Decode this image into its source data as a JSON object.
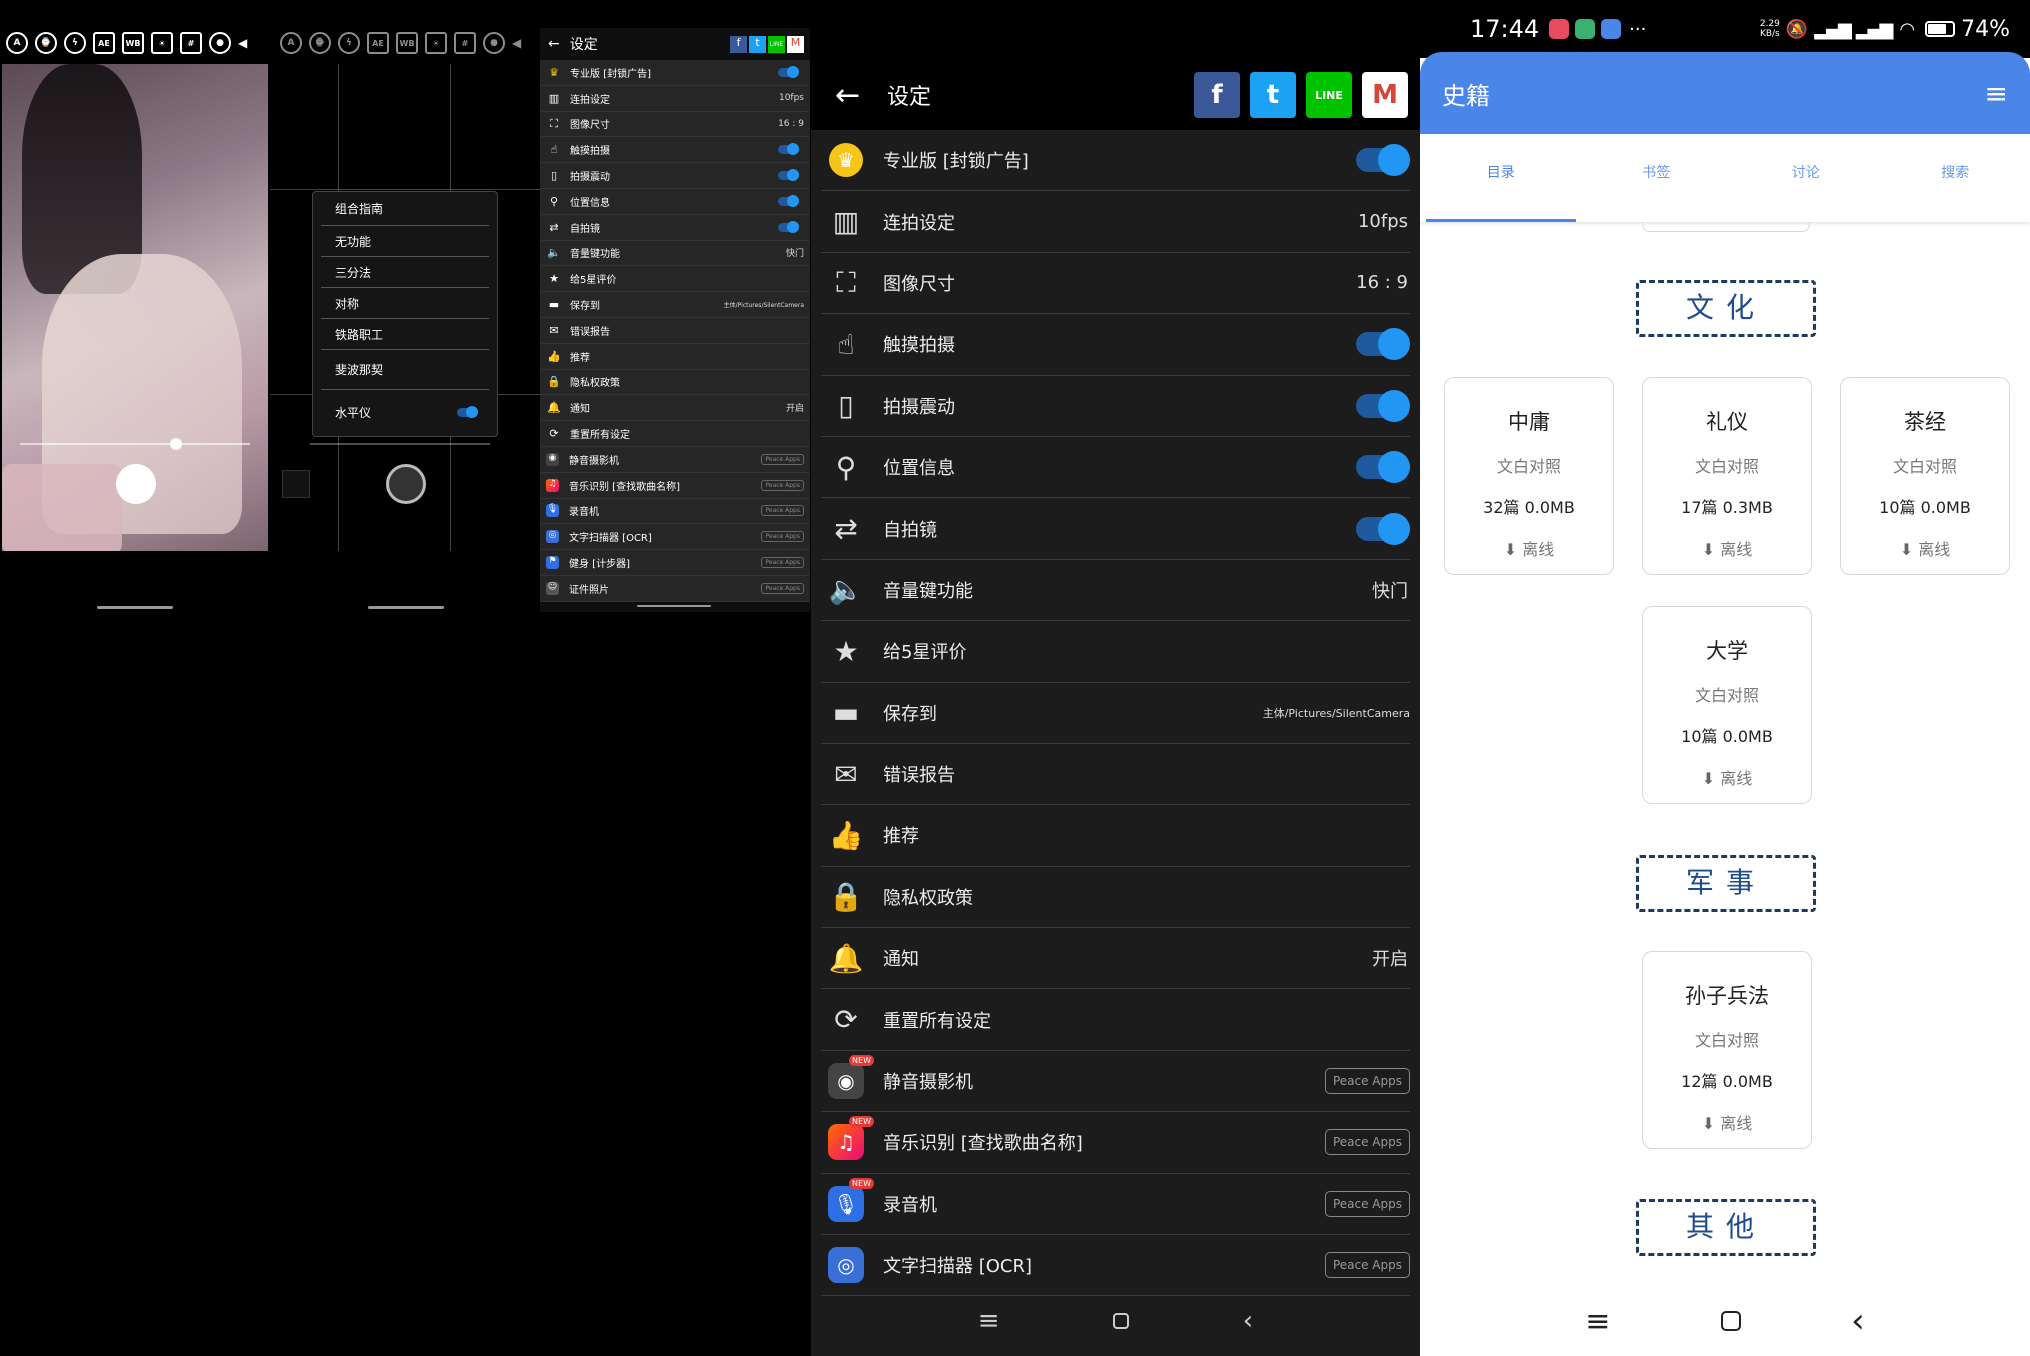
{
  "camera_grid_popup": {
    "items": [
      "组合指南",
      "无功能",
      "三分法",
      "对称",
      "铁路职工",
      "斐波那契"
    ],
    "level_label": "水平仪"
  },
  "small_settings": {
    "title": "设定",
    "rows": [
      {
        "label": "专业版 [封锁广告]",
        "value": "",
        "type": "toggle",
        "icon": "crown-icon"
      },
      {
        "label": "连拍设定",
        "value": "10fps",
        "type": "value",
        "icon": "burst-icon"
      },
      {
        "label": "图像尺寸",
        "value": "16 : 9",
        "type": "value",
        "icon": "aspect-ratio-icon"
      },
      {
        "label": "触摸拍摄",
        "value": "",
        "type": "toggle",
        "icon": "touch-icon"
      },
      {
        "label": "拍摄震动",
        "value": "",
        "type": "toggle",
        "icon": "vibrate-icon"
      },
      {
        "label": "位置信息",
        "value": "",
        "type": "toggle",
        "icon": "location-pin-icon"
      },
      {
        "label": "自拍镜",
        "value": "",
        "type": "toggle",
        "icon": "switch-camera-icon"
      },
      {
        "label": "音量键功能",
        "value": "快门",
        "type": "value",
        "icon": "volume-icon"
      },
      {
        "label": "给5星评价",
        "value": "",
        "type": "none",
        "icon": "star-icon"
      },
      {
        "label": "保存到",
        "value": "主体/Pictures/SilentCamera",
        "type": "small",
        "icon": "folder-icon"
      },
      {
        "label": "错误报告",
        "value": "",
        "type": "none",
        "icon": "mail-icon"
      },
      {
        "label": "推荐",
        "value": "",
        "type": "none",
        "icon": "thumbs-up-icon"
      },
      {
        "label": "隐私权政策",
        "value": "",
        "type": "none",
        "icon": "lock-icon"
      },
      {
        "label": "通知",
        "value": "开启",
        "type": "value",
        "icon": "bell-icon"
      },
      {
        "label": "重置所有设定",
        "value": "",
        "type": "none",
        "icon": "reset-icon"
      },
      {
        "label": "静音摄影机",
        "value": "Peace Apps",
        "type": "app",
        "icon": "silent-camera-app-icon"
      },
      {
        "label": "音乐识别 [查找歌曲名称]",
        "value": "Peace Apps",
        "type": "app",
        "icon": "music-app-icon"
      },
      {
        "label": "录音机",
        "value": "Peace Apps",
        "type": "app",
        "icon": "recorder-app-icon"
      },
      {
        "label": "文字扫描器 [OCR]",
        "value": "Peace Apps",
        "type": "app",
        "icon": "ocr-app-icon"
      },
      {
        "label": "健身 [计步器]",
        "value": "Peace Apps",
        "type": "app",
        "icon": "fitness-app-icon"
      },
      {
        "label": "证件照片",
        "value": "Peace Apps",
        "type": "app",
        "icon": "id-photo-app-icon"
      }
    ]
  },
  "big_settings": {
    "title": "设定",
    "social": [
      "f",
      "t",
      "LINE",
      "M"
    ],
    "rows": [
      {
        "label": "专业版 [封锁广告]",
        "value": "",
        "type": "toggle",
        "icon": "crown-icon"
      },
      {
        "label": "连拍设定",
        "value": "10fps",
        "type": "value",
        "icon": "burst-icon"
      },
      {
        "label": "图像尺寸",
        "value": "16 : 9",
        "type": "value",
        "icon": "aspect-ratio-icon"
      },
      {
        "label": "触摸拍摄",
        "value": "",
        "type": "toggle",
        "icon": "touch-icon"
      },
      {
        "label": "拍摄震动",
        "value": "",
        "type": "toggle",
        "icon": "vibrate-icon"
      },
      {
        "label": "位置信息",
        "value": "",
        "type": "toggle",
        "icon": "location-pin-icon"
      },
      {
        "label": "自拍镜",
        "value": "",
        "type": "toggle",
        "icon": "switch-camera-icon"
      },
      {
        "label": "音量键功能",
        "value": "快门",
        "type": "value",
        "icon": "volume-icon"
      },
      {
        "label": "给5星评价",
        "value": "",
        "type": "none",
        "icon": "star-icon"
      },
      {
        "label": "保存到",
        "value": "主体/Pictures/SilentCamera",
        "type": "small",
        "icon": "folder-icon"
      },
      {
        "label": "错误报告",
        "value": "",
        "type": "none",
        "icon": "mail-icon"
      },
      {
        "label": "推荐",
        "value": "",
        "type": "none",
        "icon": "thumbs-up-icon"
      },
      {
        "label": "隐私权政策",
        "value": "",
        "type": "none",
        "icon": "lock-icon"
      },
      {
        "label": "通知",
        "value": "开启",
        "type": "value",
        "icon": "bell-icon"
      },
      {
        "label": "重置所有设定",
        "value": "",
        "type": "none",
        "icon": "reset-icon"
      },
      {
        "label": "静音摄影机",
        "value": "Peace Apps",
        "type": "app",
        "icon": "silent-camera-app-icon"
      },
      {
        "label": "音乐识别 [查找歌曲名称]",
        "value": "Peace Apps",
        "type": "app",
        "icon": "music-app-icon"
      },
      {
        "label": "录音机",
        "value": "Peace Apps",
        "type": "app",
        "icon": "recorder-app-icon"
      },
      {
        "label": "文字扫描器 [OCR]",
        "value": "Peace Apps",
        "type": "app",
        "icon": "ocr-app-icon"
      }
    ],
    "new_badge": "NEW"
  },
  "reader": {
    "status": {
      "time": "17:44",
      "net": "2.29",
      "net_unit": "KB/s",
      "battery": "74%",
      "dots": "···"
    },
    "app_title": "史籍",
    "tabs": [
      "目录",
      "书签",
      "讨论",
      "搜索"
    ],
    "sections": [
      {
        "name": "文化",
        "books": [
          {
            "title": "中庸",
            "sub": "文白对照",
            "meta": "32篇 0.0MB",
            "action": "离线"
          },
          {
            "title": "礼仪",
            "sub": "文白对照",
            "meta": "17篇 0.3MB",
            "action": "离线"
          },
          {
            "title": "茶经",
            "sub": "文白对照",
            "meta": "10篇 0.0MB",
            "action": "离线"
          },
          {
            "title": "大学",
            "sub": "文白对照",
            "meta": "10篇 0.0MB",
            "action": "离线"
          }
        ]
      },
      {
        "name": "军事",
        "books": [
          {
            "title": "孙子兵法",
            "sub": "文白对照",
            "meta": "12篇 0.0MB",
            "action": "离线"
          }
        ]
      },
      {
        "name": "其他",
        "books": []
      }
    ]
  },
  "colors": {
    "accent": "#2196f3",
    "reader_bar": "#4a86e8",
    "section_border": "#1f3a5f"
  }
}
